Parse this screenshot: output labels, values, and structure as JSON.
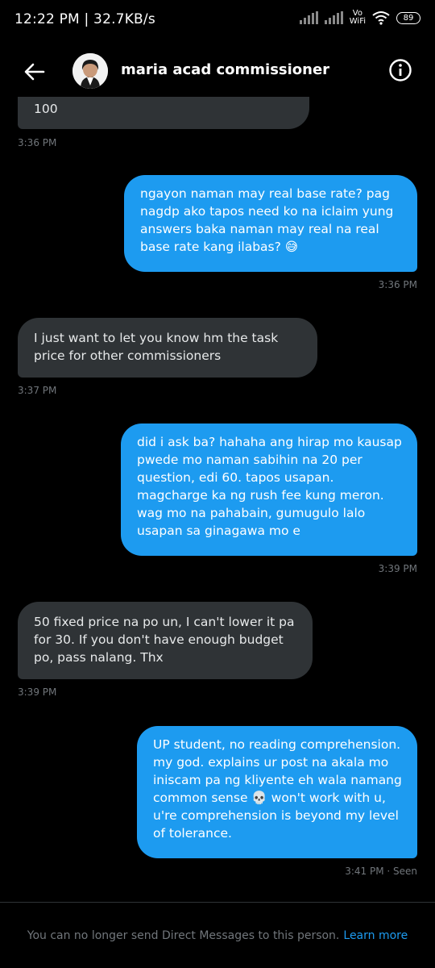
{
  "status_bar": {
    "text": "12:22 PM | 32.7KB/s",
    "vo_wifi_line1": "Vo",
    "vo_wifi_line2": "WiFi",
    "battery": "89"
  },
  "header": {
    "contact_name": "maria acad commissioner",
    "back_icon": "back-arrow-icon",
    "info_icon": "info-icon"
  },
  "messages": [
    {
      "direction": "received",
      "text": "100",
      "time": "3:36 PM"
    },
    {
      "direction": "sent",
      "text": "ngayon naman may real base rate? pag nagdp ako tapos need ko na iclaim yung answers baka naman may real na real base rate kang ilabas? 😅",
      "time": "3:36 PM"
    },
    {
      "direction": "received",
      "text": "I just want to let you know hm the task price for other commissioners",
      "time": "3:37 PM"
    },
    {
      "direction": "sent",
      "text": "did i ask ba? hahaha ang hirap mo kausap pwede mo naman sabihin na 20 per question, edi 60. tapos usapan. magcharge ka ng rush fee kung meron. wag mo na pahabain, gumugulo lalo usapan sa ginagawa mo e",
      "time": "3:39 PM"
    },
    {
      "direction": "received",
      "text": "50 fixed price na po un, I can't lower it pa for 30. If you don't have enough budget po, pass nalang. Thx",
      "time": "3:39 PM"
    },
    {
      "direction": "sent",
      "text": "UP student, no reading comprehension. my god. explains ur post na akala mo iniscam pa ng kliyente eh wala namang common sense 💀 won't work with u, u're comprehension is beyond my level of tolerance.",
      "time": "3:41 PM · Seen"
    }
  ],
  "footer": {
    "notice": "You can no longer send Direct Messages to this person.",
    "learn_more": "Learn more"
  },
  "colors": {
    "background": "#000000",
    "sent_bubble": "#1d9bf0",
    "received_bubble": "#2f3336",
    "timestamp": "#71767b",
    "link": "#1d9bf0"
  }
}
